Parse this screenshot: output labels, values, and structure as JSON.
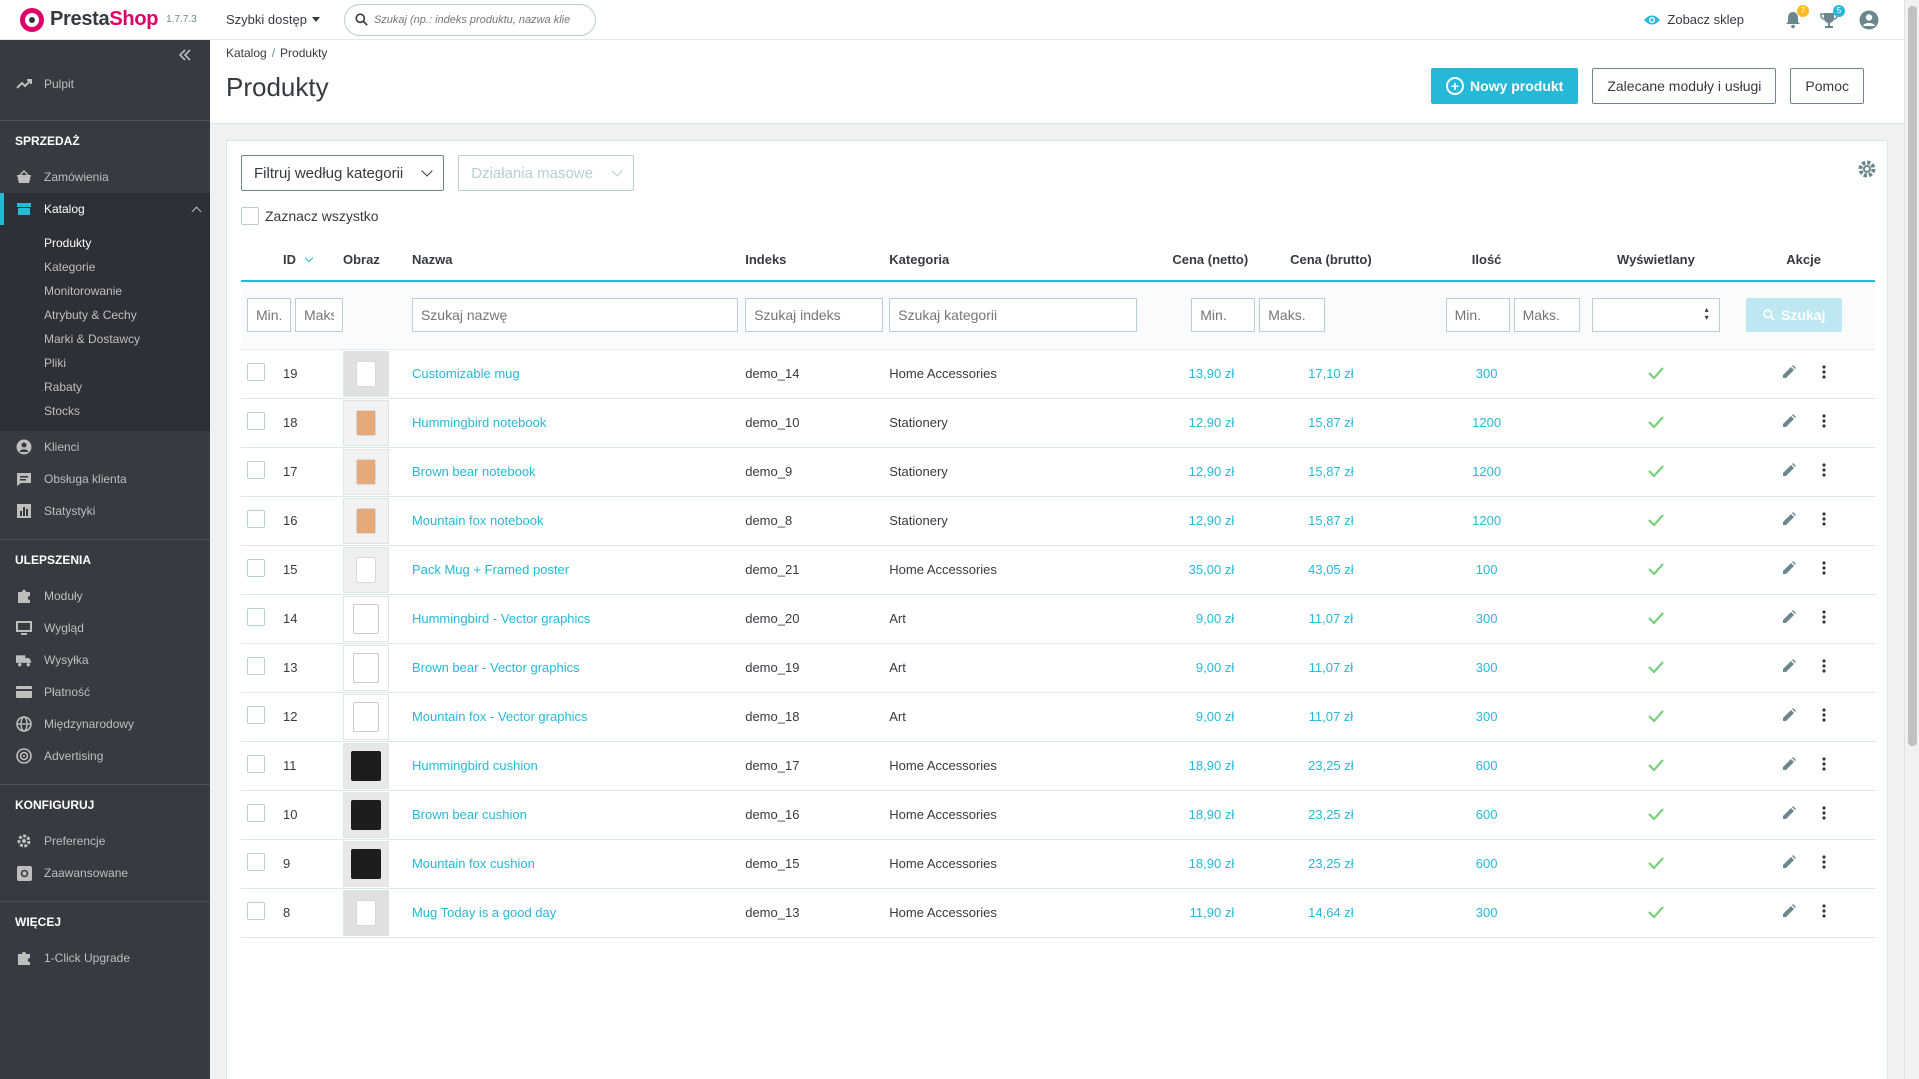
{
  "header": {
    "logo_prefix": "Presta",
    "logo_suffix": "Shop",
    "version": "1.7.7.3",
    "quick_access": "Szybki dostęp",
    "search_placeholder": "Szukaj (np.: indeks produktu, nazwa klie",
    "view_shop": "Zobacz sklep",
    "notifications_count": "7",
    "orders_count": "5"
  },
  "sidebar": {
    "dashboard": "Pulpit",
    "sections": {
      "sell": "SPRZEDAŻ",
      "improve": "ULEPSZENIA",
      "configure": "KONFIGURUJ",
      "more": "WIĘCEJ"
    },
    "sell_items": [
      "Zamówienia",
      "Katalog"
    ],
    "catalog_sub": [
      "Produkty",
      "Kategorie",
      "Monitorowanie",
      "Atrybuty & Cechy",
      "Marki & Dostawcy",
      "Pliki",
      "Rabaty",
      "Stocks"
    ],
    "sell_items2": [
      "Klienci",
      "Obsługa klienta",
      "Statystyki"
    ],
    "improve_items": [
      "Moduły",
      "Wygląd",
      "Wysyłka",
      "Płatność",
      "Międzynarodowy",
      "Advertising"
    ],
    "configure_items": [
      "Preferencje",
      "Zaawansowane"
    ],
    "more_items": [
      "1-Click Upgrade"
    ]
  },
  "page": {
    "breadcrumb": [
      "Katalog",
      "Produkty"
    ],
    "title": "Produkty",
    "new_product": "Nowy produkt",
    "recommended": "Zalecane moduły i usługi",
    "help": "Pomoc"
  },
  "toolbar": {
    "filter_category": "Filtruj według kategorii",
    "bulk_actions": "Działania masowe",
    "select_all": "Zaznacz wszystko"
  },
  "table": {
    "headers": {
      "id": "ID",
      "image": "Obraz",
      "name": "Nazwa",
      "reference": "Indeks",
      "category": "Kategoria",
      "price_net": "Cena (netto)",
      "price_gross": "Cena (brutto)",
      "quantity": "Ilość",
      "displayed": "Wyświetlany",
      "actions": "Akcje"
    },
    "filters": {
      "id_min": "Min.",
      "id_max": "Maks",
      "name": "Szukaj nazwę",
      "reference": "Szukaj indeks",
      "category": "Szukaj kategorii",
      "price_min": "Min.",
      "price_max": "Maks.",
      "qty_min": "Min.",
      "qty_max": "Maks.",
      "search_button": "Szukaj"
    },
    "rows": [
      {
        "id": "19",
        "name": "Customizable mug",
        "ref": "demo_14",
        "cat": "Home Accessories",
        "net": "13,90 zł",
        "gross": "17,10 zł",
        "qty": "300",
        "thumb": "mug"
      },
      {
        "id": "18",
        "name": "Hummingbird notebook",
        "ref": "demo_10",
        "cat": "Stationery",
        "net": "12,90 zł",
        "gross": "15,87 zł",
        "qty": "1200",
        "thumb": "notebook"
      },
      {
        "id": "17",
        "name": "Brown bear notebook",
        "ref": "demo_9",
        "cat": "Stationery",
        "net": "12,90 zł",
        "gross": "15,87 zł",
        "qty": "1200",
        "thumb": "notebook"
      },
      {
        "id": "16",
        "name": "Mountain fox notebook",
        "ref": "demo_8",
        "cat": "Stationery",
        "net": "12,90 zł",
        "gross": "15,87 zł",
        "qty": "1200",
        "thumb": "notebook"
      },
      {
        "id": "15",
        "name": "Pack Mug + Framed poster",
        "ref": "demo_21",
        "cat": "Home Accessories",
        "net": "35,00 zł",
        "gross": "43,05 zł",
        "qty": "100",
        "thumb": "poster"
      },
      {
        "id": "14",
        "name": "Hummingbird - Vector graphics",
        "ref": "demo_20",
        "cat": "Art",
        "net": "9,00 zł",
        "gross": "11,07 zł",
        "qty": "300",
        "thumb": "vector"
      },
      {
        "id": "13",
        "name": "Brown bear - Vector graphics",
        "ref": "demo_19",
        "cat": "Art",
        "net": "9,00 zł",
        "gross": "11,07 zł",
        "qty": "300",
        "thumb": "vector"
      },
      {
        "id": "12",
        "name": "Mountain fox - Vector graphics",
        "ref": "demo_18",
        "cat": "Art",
        "net": "9,00 zł",
        "gross": "11,07 zł",
        "qty": "300",
        "thumb": "vector"
      },
      {
        "id": "11",
        "name": "Hummingbird cushion",
        "ref": "demo_17",
        "cat": "Home Accessories",
        "net": "18,90 zł",
        "gross": "23,25 zł",
        "qty": "600",
        "thumb": "cushion"
      },
      {
        "id": "10",
        "name": "Brown bear cushion",
        "ref": "demo_16",
        "cat": "Home Accessories",
        "net": "18,90 zł",
        "gross": "23,25 zł",
        "qty": "600",
        "thumb": "cushion"
      },
      {
        "id": "9",
        "name": "Mountain fox cushion",
        "ref": "demo_15",
        "cat": "Home Accessories",
        "net": "18,90 zł",
        "gross": "23,25 zł",
        "qty": "600",
        "thumb": "cushion"
      },
      {
        "id": "8",
        "name": "Mug Today is a good day",
        "ref": "demo_13",
        "cat": "Home Accessories",
        "net": "11,90 zł",
        "gross": "14,64 zł",
        "qty": "300",
        "thumb": "mug"
      }
    ]
  },
  "colors": {
    "accent": "#25b9d7",
    "sidebar_bg": "#363a41",
    "brand_pink": "#df0067",
    "check_green": "#78d07d"
  }
}
